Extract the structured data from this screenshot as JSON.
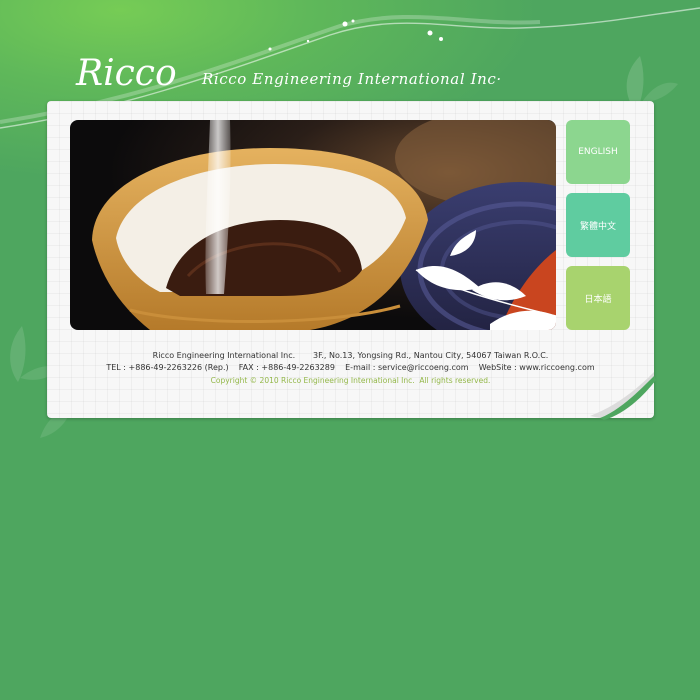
{
  "header": {
    "logo_text": "Ricco",
    "company_banner": "Ricco Engineering International Inc·"
  },
  "languages": [
    {
      "label": "ENGLISH"
    },
    {
      "label": "繁體中文"
    },
    {
      "label": "日本語"
    }
  ],
  "footer": {
    "line1": "Ricco Engineering International Inc.       3F., No.13, Yongsing Rd., Nantou City, 54067 Taiwan R.O.C.",
    "line2": "TEL : +886-49-2263226 (Rep.)    FAX : +886-49-2263289    E-mail : service@riccoeng.com    WebSite : www.riccoeng.com",
    "copyright": "Copyright © 2010 Ricco Engineering International Inc.  All rights reserved."
  },
  "colors": {
    "background": "#4ea65f",
    "lang_english": "#8cd68f",
    "lang_chinese": "#5fcca0",
    "lang_japanese": "#a8d36e",
    "copyright_text": "#94b84a"
  }
}
